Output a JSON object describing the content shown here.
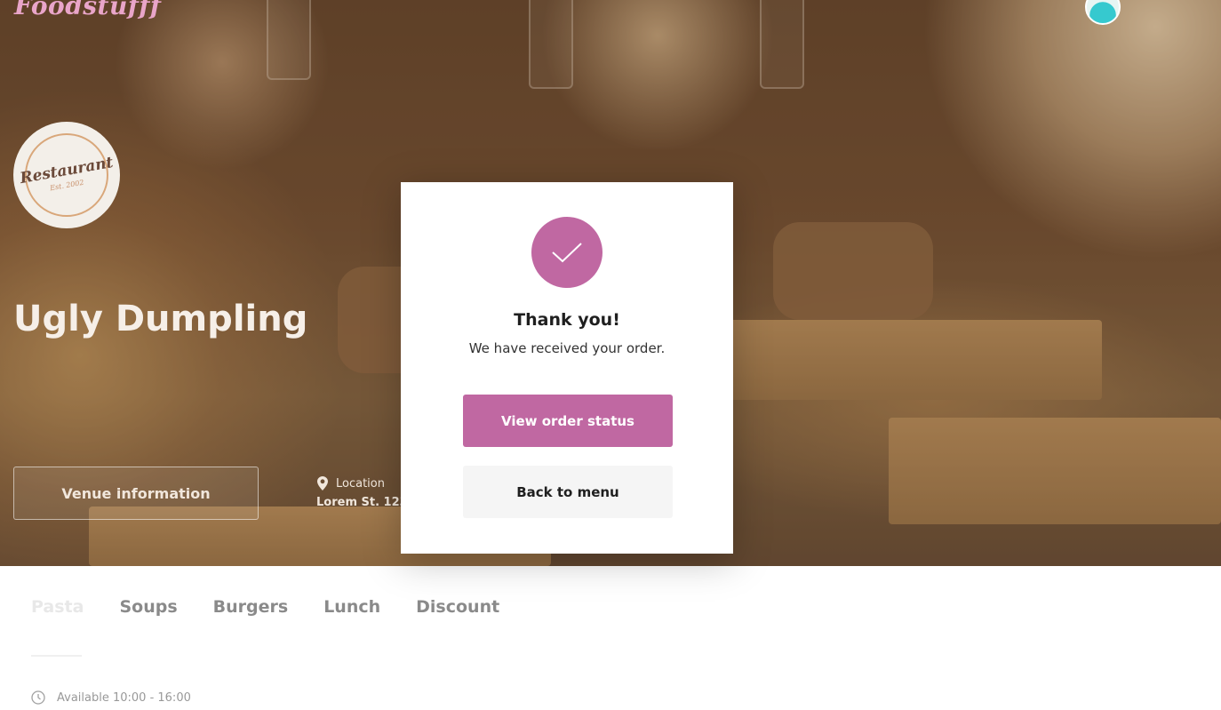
{
  "header": {
    "brand": "Foodstufff",
    "avatar_icon": "user-avatar"
  },
  "venue": {
    "badge_title": "Restaurant",
    "badge_sub": "Est. 2002",
    "name": "Ugly Dumpling",
    "info_button": "Venue information",
    "location_label": "Location",
    "location_address": "Lorem St. 123"
  },
  "modal": {
    "icon": "check-icon",
    "title": "Thank you!",
    "message": "We have received your order.",
    "primary_button": "View order status",
    "secondary_button": "Back to menu"
  },
  "menu": {
    "tabs": [
      {
        "label": "Pasta",
        "active": true
      },
      {
        "label": "Soups",
        "active": false
      },
      {
        "label": "Burgers",
        "active": false
      },
      {
        "label": "Lunch",
        "active": false
      },
      {
        "label": "Discount",
        "active": false
      }
    ],
    "availability": "Available 10:00 - 16:00"
  },
  "colors": {
    "accent": "#c068a2",
    "brand_pink": "#e9a5c9",
    "secondary_button_bg": "#f5f5f5"
  }
}
